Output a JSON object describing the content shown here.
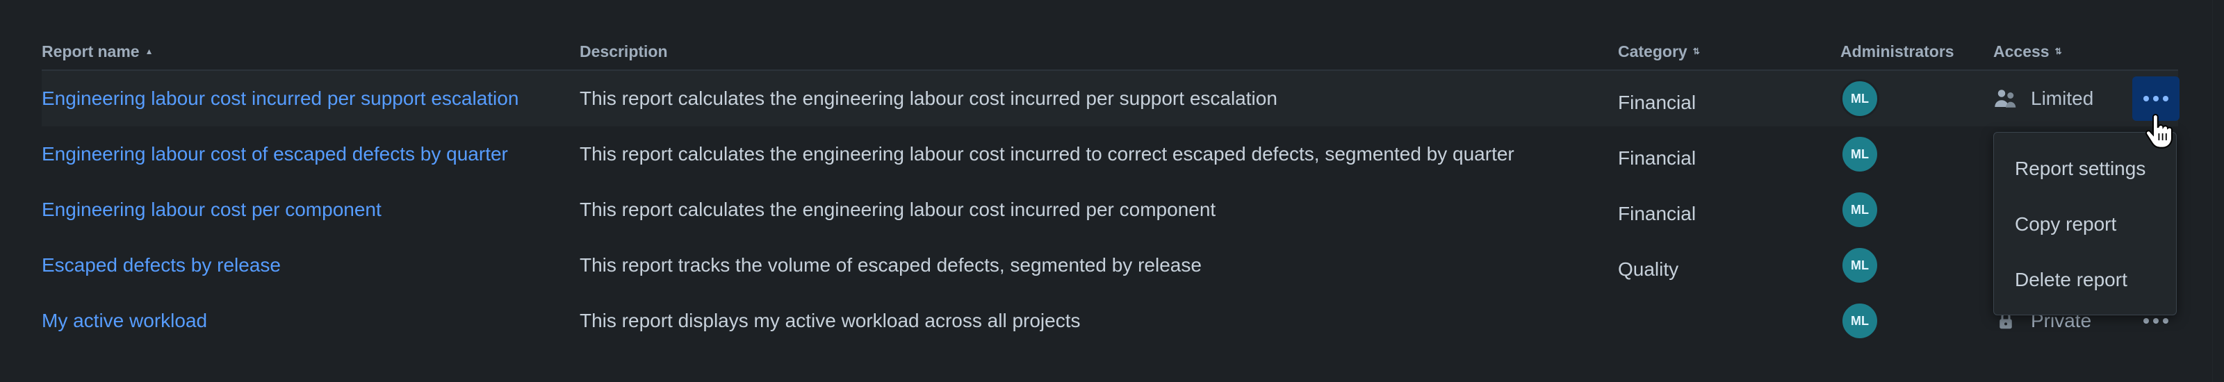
{
  "columns": {
    "report_name": "Report name",
    "description": "Description",
    "category": "Category",
    "administrators": "Administrators",
    "access": "Access"
  },
  "rows": [
    {
      "name": "Engineering labour cost incurred per support escalation",
      "description": "This report calculates the engineering labour cost incurred per support escalation",
      "category": "Financial",
      "admin_initials": "ML",
      "access": "Limited",
      "access_icon": "people-icon"
    },
    {
      "name": "Engineering labour cost of escaped defects by quarter",
      "description": "This report calculates the engineering labour cost incurred to correct escaped defects, segmented by quarter",
      "category": "Financial",
      "admin_initials": "ML",
      "access": "",
      "access_icon": ""
    },
    {
      "name": "Engineering labour cost per component",
      "description": "This report calculates the engineering labour cost incurred per component",
      "category": "Financial",
      "admin_initials": "ML",
      "access": "",
      "access_icon": ""
    },
    {
      "name": "Escaped defects by release",
      "description": "This report tracks the volume of escaped defects, segmented by release",
      "category": "Quality",
      "admin_initials": "ML",
      "access": "",
      "access_icon": ""
    },
    {
      "name": "My active workload",
      "description": "This report displays my active workload across all projects",
      "category": "",
      "admin_initials": "ML",
      "access": "Private",
      "access_icon": "lock-icon"
    }
  ],
  "menu": {
    "items": [
      "Report settings",
      "Copy report",
      "Delete report"
    ]
  },
  "colors": {
    "background": "#1d2125",
    "link": "#579dff",
    "avatar": "#1d7f8c",
    "active_button": "#09326c"
  }
}
